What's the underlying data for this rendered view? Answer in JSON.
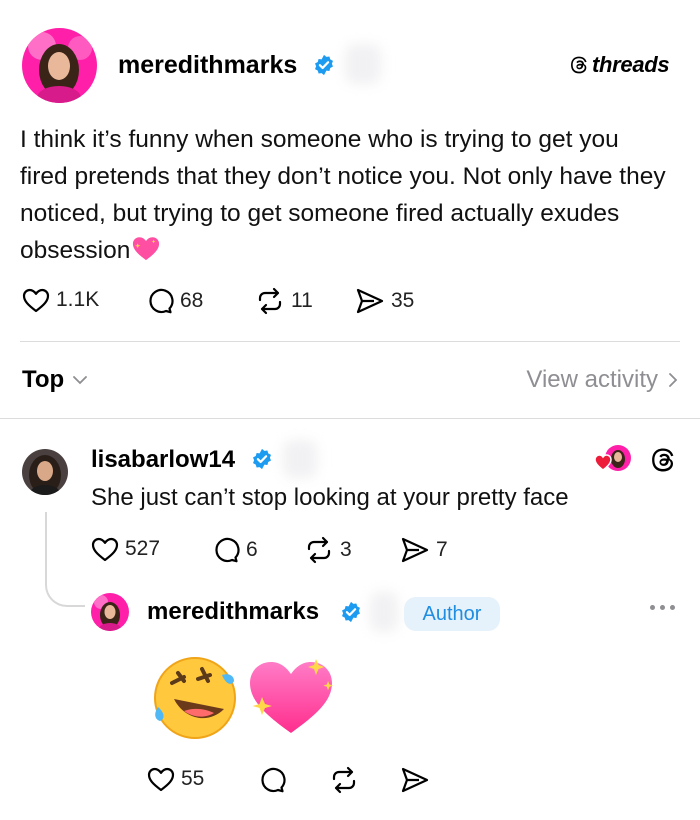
{
  "post": {
    "username": "meredithmarks",
    "brand": "threads",
    "text": "I think it’s funny when someone who is trying to get you fired pretends that they don’t notice you.  Not only have they noticed, but trying to get someone fired actually exudes obsession",
    "likes": "1.1K",
    "comments": "68",
    "reposts": "11",
    "shares": "35"
  },
  "sort": {
    "label": "Top",
    "view_activity": "View activity"
  },
  "reply1": {
    "username": "lisabarlow14",
    "text": "She just can’t stop looking at your pretty face",
    "likes": "527",
    "comments": "6",
    "reposts": "3",
    "shares": "7"
  },
  "reply2": {
    "username": "meredithmarks",
    "badge": "Author",
    "likes": "55"
  },
  "colors": {
    "verified": "#1d9bf0",
    "author_badge_bg": "#e5f1fb",
    "author_badge_text": "#1f8de0",
    "muted": "#8e8e93"
  }
}
